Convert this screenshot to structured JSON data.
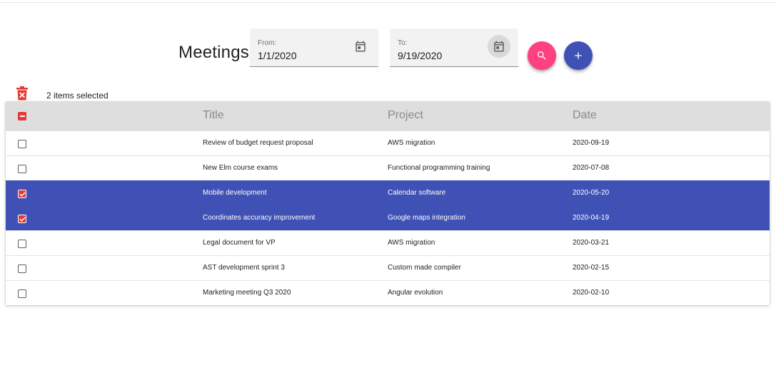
{
  "header": {
    "title": "Meetings",
    "from": {
      "label": "From:",
      "value": "1/1/2020"
    },
    "to": {
      "label": "To:",
      "value": "9/19/2020"
    }
  },
  "icons": {
    "calendar": "calendar-icon",
    "search": "search-icon",
    "add": "plus-icon",
    "delete": "trash-icon"
  },
  "colors": {
    "primary": "#3f51b5",
    "accent": "#ff4081",
    "warn": "#e53935"
  },
  "selection": {
    "text": "2 items selected"
  },
  "table": {
    "columns": [
      "Title",
      "Project",
      "Date"
    ],
    "rows": [
      {
        "title": "Review of budget request proposal",
        "project": "AWS migration",
        "date": "2020-09-19",
        "checked": false
      },
      {
        "title": "New Elm course exams",
        "project": "Functional programming training",
        "date": "2020-07-08",
        "checked": false
      },
      {
        "title": "Mobile development",
        "project": "Calendar software",
        "date": "2020-05-20",
        "checked": true
      },
      {
        "title": "Coordinates accuracy improvement",
        "project": "Google maps integration",
        "date": "2020-04-19",
        "checked": true
      },
      {
        "title": "Legal document for VP",
        "project": "AWS migration",
        "date": "2020-03-21",
        "checked": false
      },
      {
        "title": "AST development sprint 3",
        "project": "Custom made compiler",
        "date": "2020-02-15",
        "checked": false
      },
      {
        "title": "Marketing meeting Q3 2020",
        "project": "Angular evolution",
        "date": "2020-02-10",
        "checked": false
      }
    ]
  }
}
